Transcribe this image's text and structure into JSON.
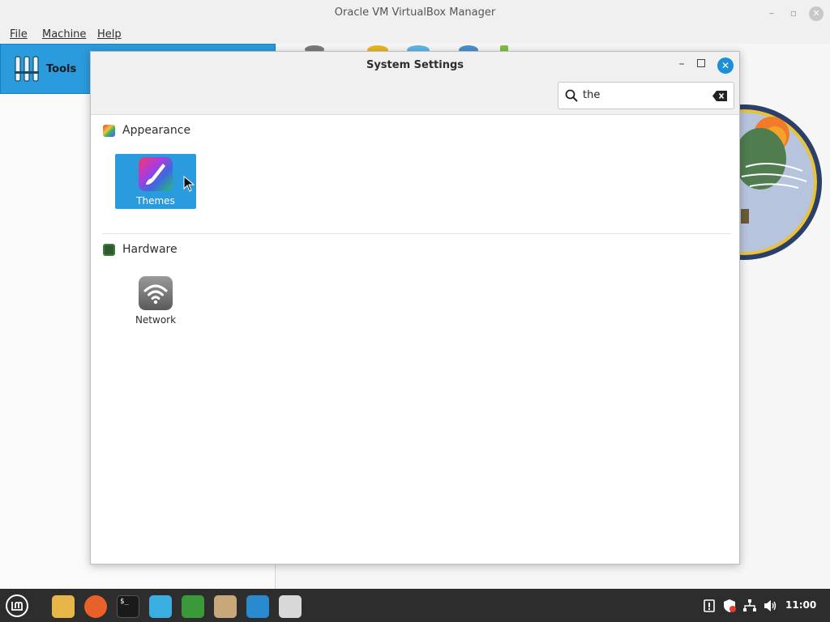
{
  "vbox": {
    "title": "Oracle VM VirtualBox Manager",
    "menu": {
      "file": "File",
      "machine": "Machine",
      "help": "Help"
    },
    "tools_label": "Tools"
  },
  "dialog": {
    "title": "System Settings",
    "search": {
      "value": "the",
      "placeholder": ""
    },
    "sections": [
      {
        "label": "Appearance",
        "icon": "appearance-icon",
        "items": [
          {
            "label": "Themes",
            "icon": "themes-icon",
            "selected": true
          }
        ]
      },
      {
        "label": "Hardware",
        "icon": "hardware-icon",
        "items": [
          {
            "label": "Network",
            "icon": "network-icon",
            "selected": false
          }
        ]
      }
    ]
  },
  "taskbar": {
    "apps": [
      "menu-icon",
      "files-icon",
      "firefox-icon",
      "terminal-icon",
      "mintinstall-icon",
      "shield-icon",
      "folder-icon",
      "monitor-icon",
      "settings-icon"
    ],
    "tray": [
      "notes-icon",
      "update-shield-icon",
      "network-tray-icon",
      "volume-icon"
    ],
    "clock": "11:00"
  },
  "colors": {
    "accent": "#2a9bdc",
    "taskbar": "#2d2d2d"
  }
}
